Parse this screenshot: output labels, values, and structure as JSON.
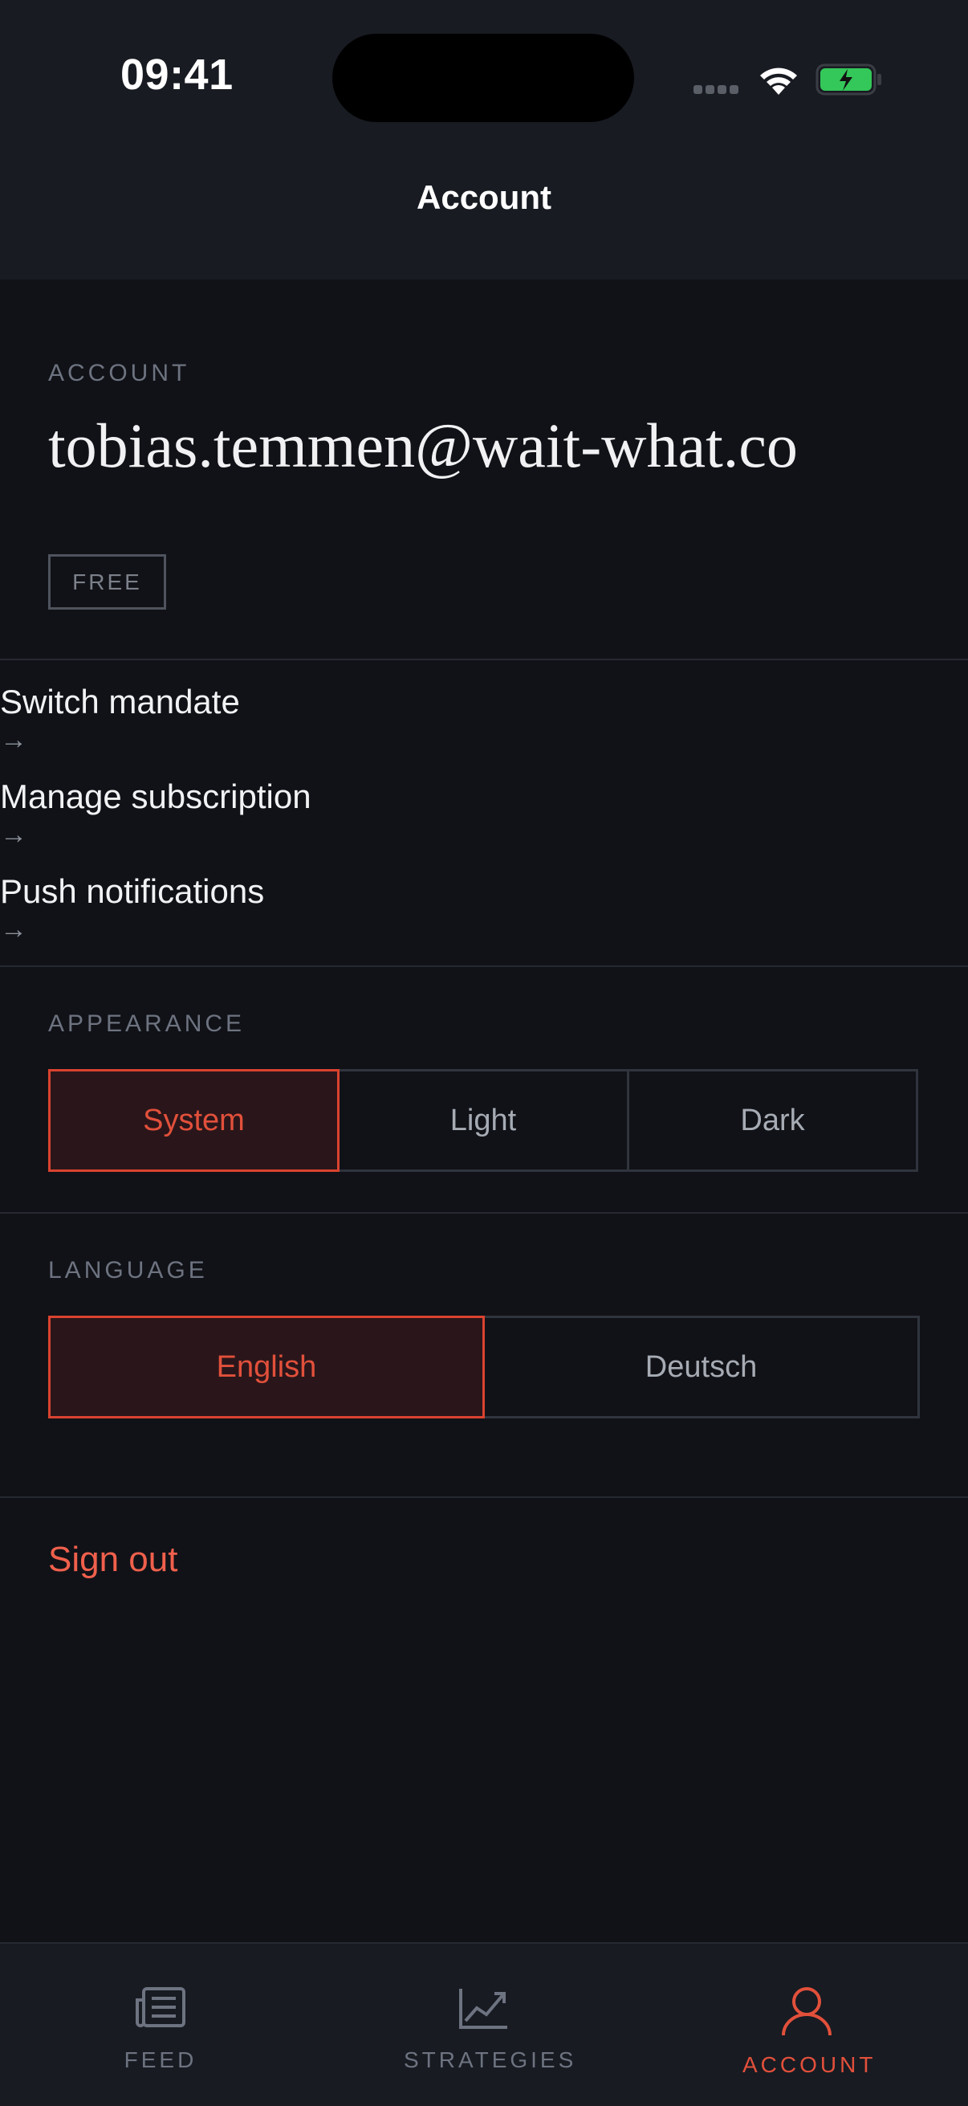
{
  "status_bar": {
    "time": "09:41"
  },
  "nav": {
    "title": "Account"
  },
  "account": {
    "section_label": "ACCOUNT",
    "email": "tobias.temmen@wait-what.co",
    "tier": "FREE"
  },
  "menu": [
    {
      "label": "Switch mandate",
      "arrow": "→"
    },
    {
      "label": "Manage subscription",
      "arrow": "→"
    },
    {
      "label": "Push notifications",
      "arrow": "→"
    }
  ],
  "appearance": {
    "section_label": "APPEARANCE",
    "options": [
      "System",
      "Light",
      "Dark"
    ],
    "selected": "System"
  },
  "language": {
    "section_label": "LANGUAGE",
    "options": [
      "English",
      "Deutsch"
    ],
    "selected": "English"
  },
  "sign_out_label": "Sign out",
  "tabs": [
    {
      "label": "FEED",
      "icon": "newspaper-icon"
    },
    {
      "label": "STRATEGIES",
      "icon": "chart-line-icon"
    },
    {
      "label": "ACCOUNT",
      "icon": "user-icon",
      "active": true
    }
  ],
  "colors": {
    "accent": "#e2503b",
    "background": "#111217",
    "bar_background": "#181b22"
  }
}
